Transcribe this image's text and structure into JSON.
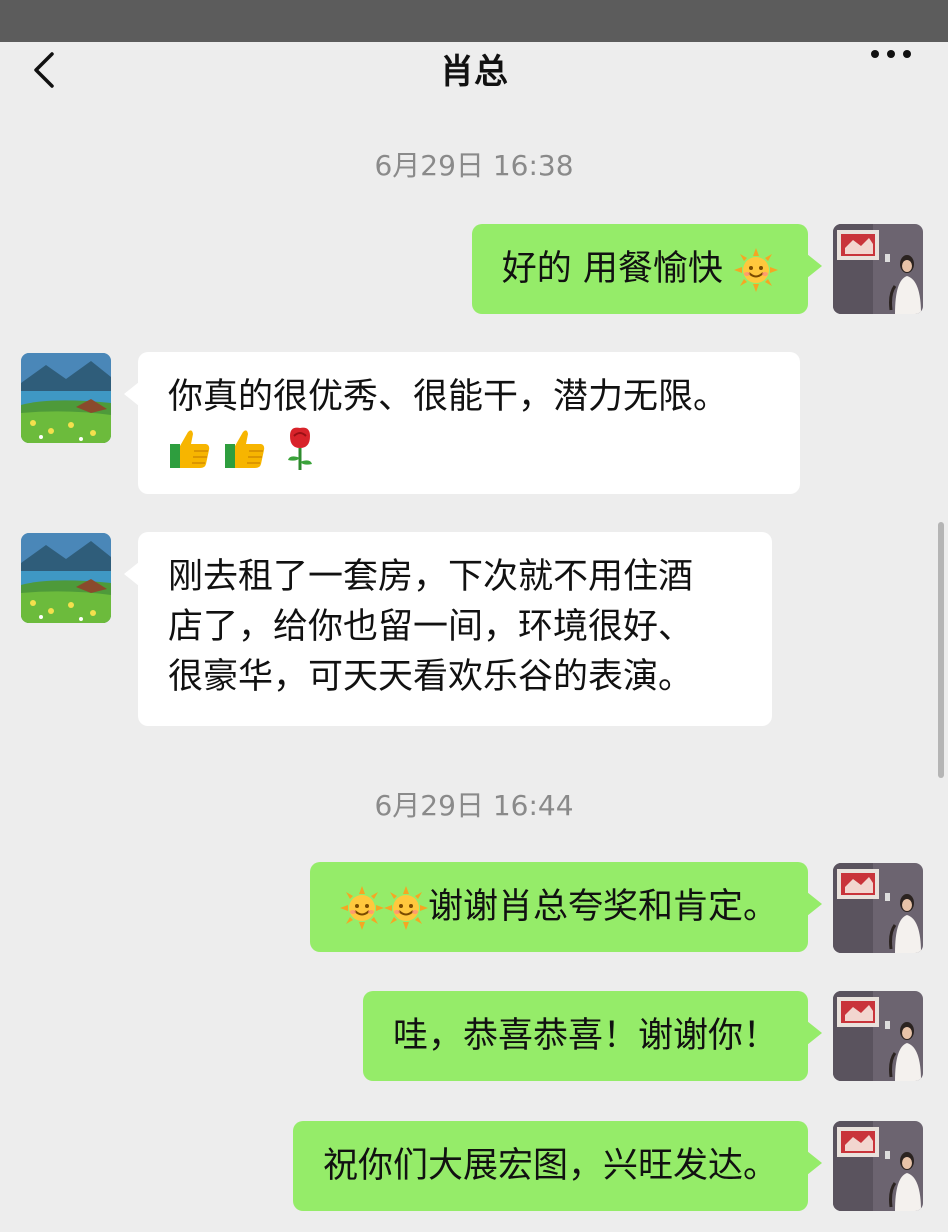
{
  "header": {
    "title": "肖总"
  },
  "icons": {
    "back": "chevron-left-icon",
    "more": "more-dots-icon",
    "sun": "sun-smile-emoji",
    "thumbs_up": "thumbs-up-emoji",
    "rose": "rose-emoji"
  },
  "colors": {
    "my_bubble": "#95ec69",
    "their_bubble": "#ffffff",
    "background": "#ededed"
  },
  "timestamps": [
    "6月29日 16:38",
    "6月29日 16:44"
  ],
  "messages": [
    {
      "from": "me",
      "text": "好的 用餐愉快"
    },
    {
      "from": "them",
      "text": "你真的很优秀、很能干，潜力无限。"
    },
    {
      "from": "them",
      "lines": [
        "刚去租了一套房，下次就不用住酒",
        "店了，给你也留一间，环境很好、",
        "很豪华，可天天看欢乐谷的表演。"
      ]
    },
    {
      "from": "me",
      "text": "谢谢肖总夸奖和肯定。"
    },
    {
      "from": "me",
      "text": "哇，恭喜恭喜！谢谢你！"
    },
    {
      "from": "me",
      "text": "祝你们大展宏图，兴旺发达。"
    }
  ]
}
